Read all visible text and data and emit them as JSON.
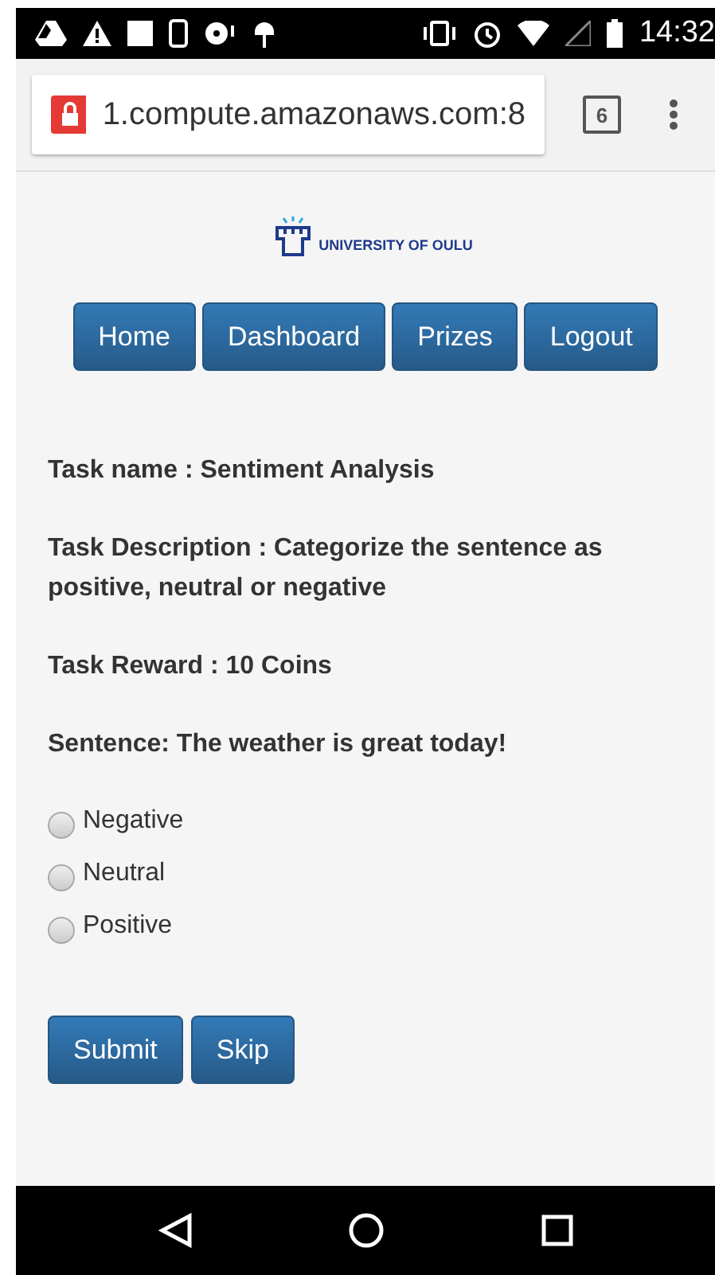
{
  "status_bar": {
    "time": "14:32"
  },
  "browser": {
    "url": "1.compute.amazonaws.com:8",
    "tab_count": "6"
  },
  "logo": {
    "text": "UNIVERSITY OF OULU"
  },
  "nav": [
    "Home",
    "Dashboard",
    "Prizes",
    "Logout"
  ],
  "task": {
    "name": "Task name : Sentiment Analysis",
    "description": "Task Description : Categorize the sentence as positive, neutral or negative",
    "reward": "Task Reward : 10 Coins",
    "sentence": "Sentence: The weather is great today!"
  },
  "options": [
    {
      "label": "Negative",
      "selected": false
    },
    {
      "label": "Neutral",
      "selected": false
    },
    {
      "label": "Positive",
      "selected": false
    }
  ],
  "actions": [
    "Submit",
    "Skip"
  ]
}
